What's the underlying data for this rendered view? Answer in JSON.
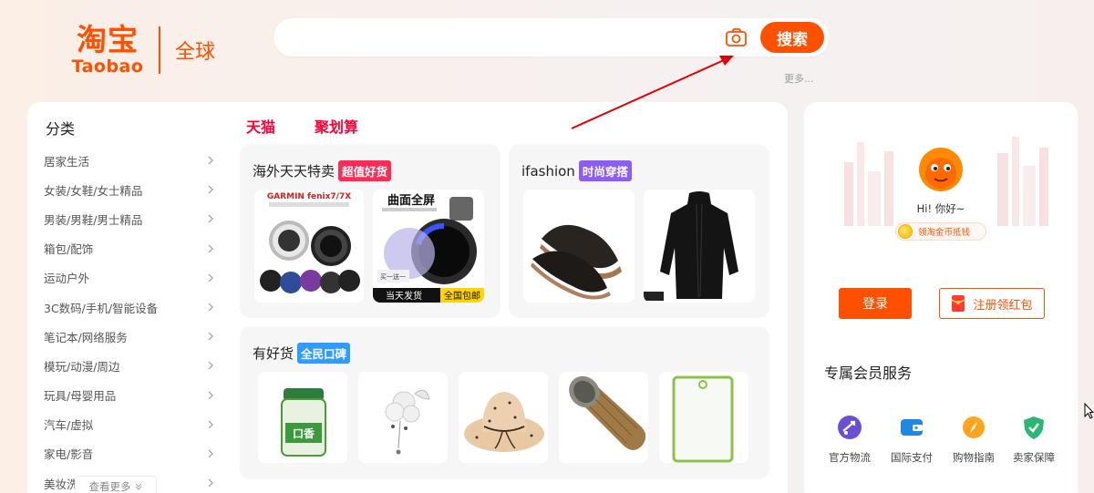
{
  "header": {
    "logo_cn": "淘宝",
    "logo_en": "Taobao",
    "region_label": "全球",
    "search_placeholder": "",
    "search_button": "搜索",
    "more_link": "更多..."
  },
  "categories": {
    "title": "分类",
    "items": [
      "居家生活",
      "女装/女鞋/女士精品",
      "男装/男鞋/男士精品",
      "箱包/配饰",
      "运动户外",
      "3C数码/手机/智能设备",
      "笔记本/网络服务",
      "模玩/动漫/周边",
      "玩具/母婴用品",
      "汽车/虚拟",
      "家电/影音",
      "美妆洗护"
    ],
    "see_more": "查看更多"
  },
  "tabs": [
    "天猫",
    "聚划算"
  ],
  "panels": {
    "overseas": {
      "title": "海外天天特卖",
      "tag": "超值好货",
      "tag_color": "#ff2a55"
    },
    "ifashion": {
      "title": "ifashion",
      "tag": "时尚穿搭",
      "tag_color": "#8b5cf6"
    },
    "good": {
      "title": "有好货",
      "tag": "全民口碑",
      "tag_color": "#2f9cff"
    }
  },
  "product_texts": {
    "watch1_brand": "GARMIN fenix7/7X",
    "watch2_headline": "曲面全屏",
    "watch2_badge_left": "当天发货",
    "watch2_badge_right": "全国包邮",
    "watch2_promo": "买一送一",
    "gum_label": "口香"
  },
  "user": {
    "greeting": "Hi! 你好~",
    "coin_text": "领淘金币抵钱",
    "login_button": "登录",
    "register_button": "注册领红包"
  },
  "services": {
    "title": "专属会员服务",
    "items": [
      {
        "label": "官方物流",
        "icon": "delivery-icon",
        "color": "#6c4dd6"
      },
      {
        "label": "国际支付",
        "icon": "wallet-icon",
        "color": "#1e88e5"
      },
      {
        "label": "购物指南",
        "icon": "compass-icon",
        "color": "#ffa41c"
      },
      {
        "label": "卖家保障",
        "icon": "shield-icon",
        "color": "#2bb673"
      }
    ]
  },
  "colors": {
    "brand": "#ff5000",
    "tmall": "#ff0036",
    "annotation": "#e00000"
  }
}
